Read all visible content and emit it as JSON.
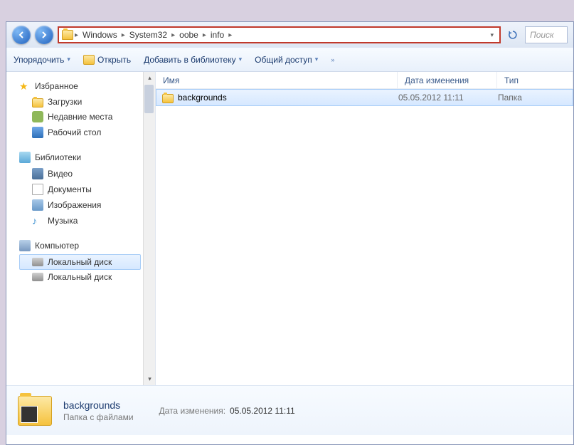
{
  "breadcrumb": [
    "Windows",
    "System32",
    "oobe",
    "info"
  ],
  "search": {
    "placeholder": "Поиск"
  },
  "toolbar": {
    "organize": "Упорядочить",
    "open": "Открыть",
    "addToLibrary": "Добавить в библиотеку",
    "share": "Общий доступ"
  },
  "sidebar": {
    "favorites": {
      "label": "Избранное",
      "items": [
        {
          "label": "Загрузки",
          "icon": "folder"
        },
        {
          "label": "Недавние места",
          "icon": "recent"
        },
        {
          "label": "Рабочий стол",
          "icon": "desktop"
        }
      ]
    },
    "libraries": {
      "label": "Библиотеки",
      "items": [
        {
          "label": "Видео",
          "icon": "vid"
        },
        {
          "label": "Документы",
          "icon": "doc"
        },
        {
          "label": "Изображения",
          "icon": "img"
        },
        {
          "label": "Музыка",
          "icon": "music"
        }
      ]
    },
    "computer": {
      "label": "Компьютер",
      "items": [
        {
          "label": "Локальный диск",
          "icon": "disk",
          "sel": true
        },
        {
          "label": "Локальный диск",
          "icon": "disk"
        }
      ]
    }
  },
  "columns": {
    "name": "Имя",
    "date": "Дата изменения",
    "type": "Тип"
  },
  "files": [
    {
      "name": "backgrounds",
      "date": "05.05.2012 11:11",
      "type": "Папка"
    }
  ],
  "details": {
    "title": "backgrounds",
    "subtitle": "Папка с файлами",
    "dateLabel": "Дата изменения:",
    "dateValue": "05.05.2012 11:11"
  }
}
